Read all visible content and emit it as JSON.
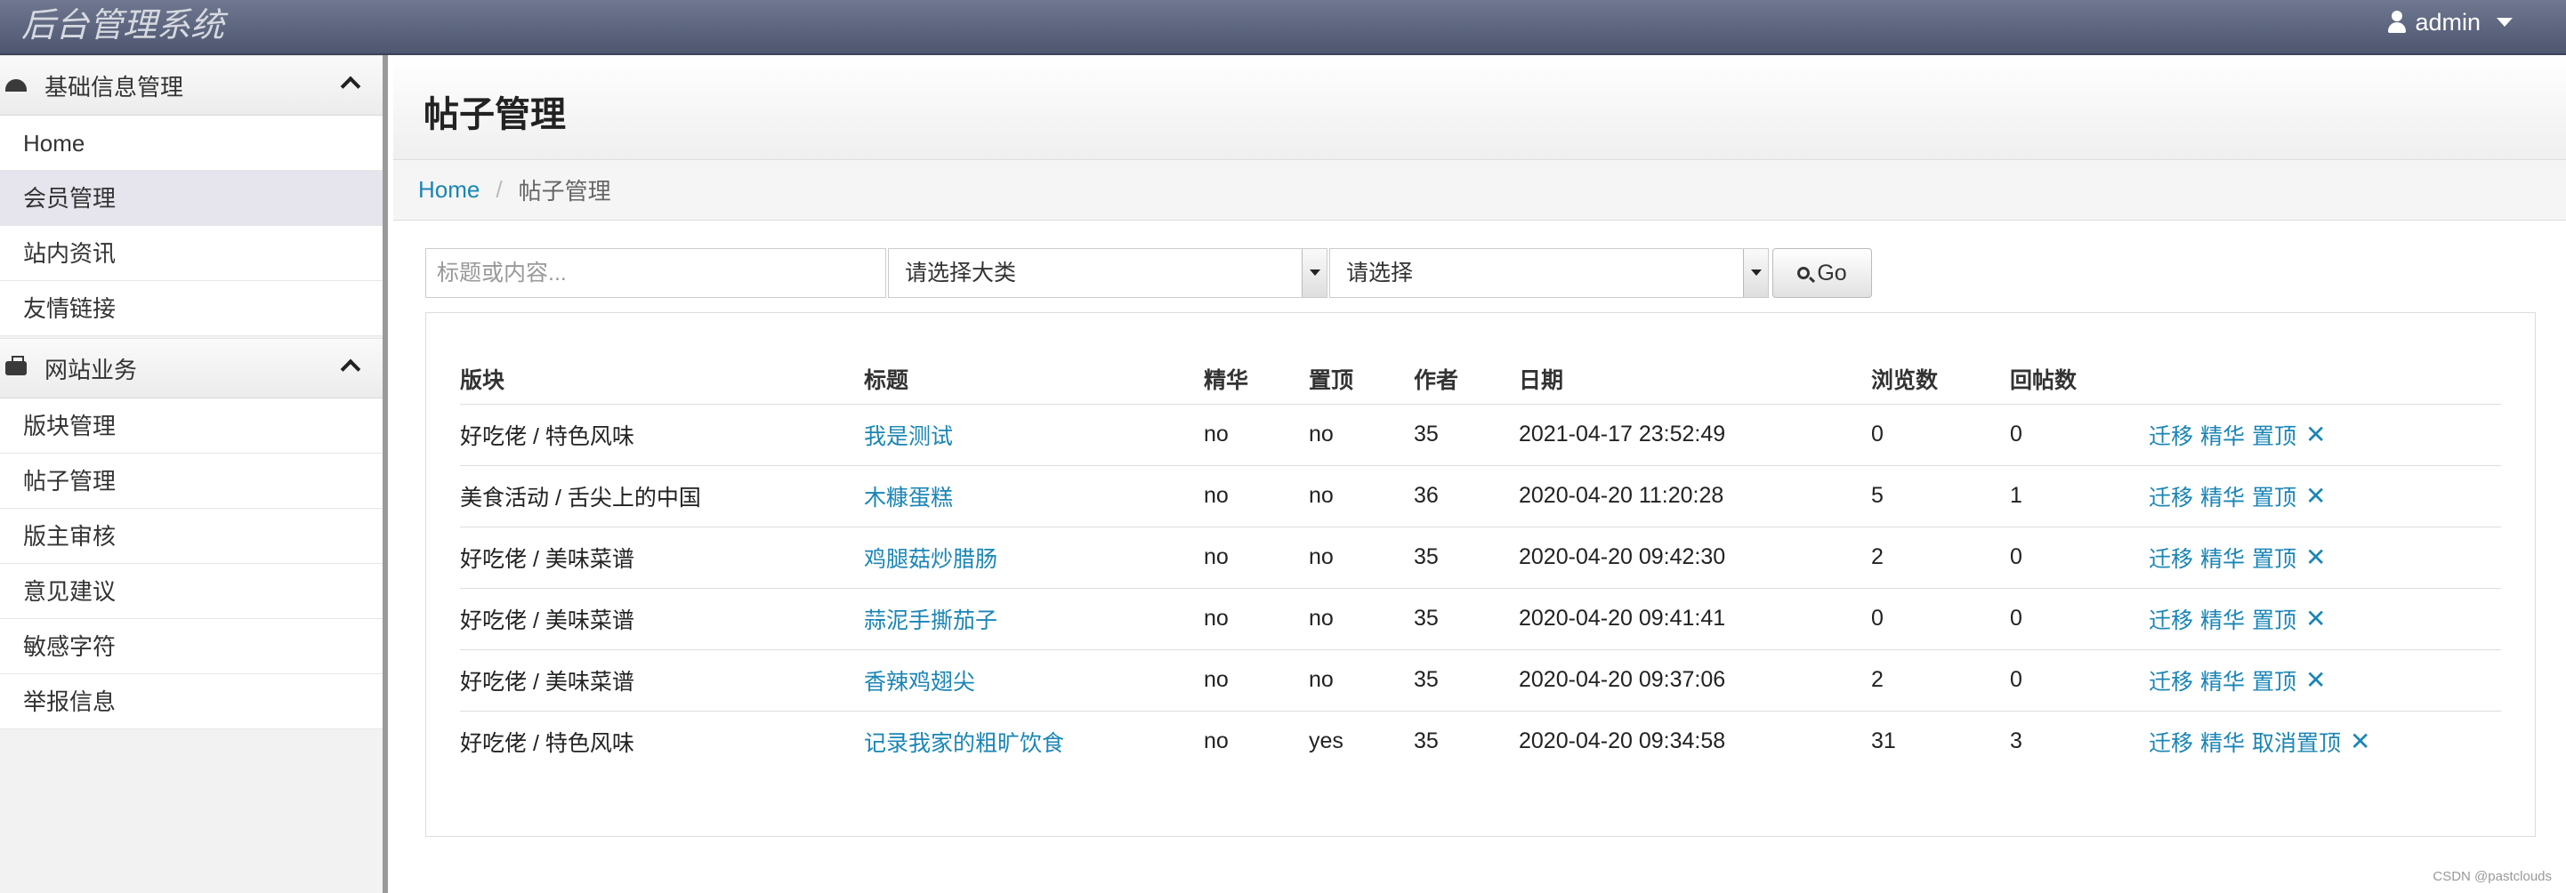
{
  "app": {
    "brand": "后台管理系统",
    "user": "admin"
  },
  "sidebar": {
    "groups": [
      {
        "label": "基础信息管理",
        "icon": "dashboard-icon",
        "items": [
          {
            "label": "Home"
          },
          {
            "label": "会员管理",
            "active": true
          },
          {
            "label": "站内资讯"
          },
          {
            "label": "友情链接"
          }
        ]
      },
      {
        "label": "网站业务",
        "icon": "briefcase-icon",
        "items": [
          {
            "label": "版块管理"
          },
          {
            "label": "帖子管理"
          },
          {
            "label": "版主审核"
          },
          {
            "label": "意见建议"
          },
          {
            "label": "敏感字符"
          },
          {
            "label": "举报信息"
          }
        ]
      }
    ]
  },
  "page": {
    "title": "帖子管理"
  },
  "breadcrumb": {
    "home": "Home",
    "separator": "/",
    "current": "帖子管理"
  },
  "filter": {
    "search_placeholder": "标题或内容...",
    "category_select": "请选择大类",
    "sub_select": "请选择",
    "go_label": "Go"
  },
  "table": {
    "headers": [
      "版块",
      "标题",
      "精华",
      "置顶",
      "作者",
      "日期",
      "浏览数",
      "回帖数",
      ""
    ],
    "rows": [
      {
        "board": "好吃佬 / 特色风味",
        "title": "我是测试",
        "featured": "no",
        "pinned": "no",
        "author": "35",
        "date": "2021-04-17 23:52:49",
        "views": "0",
        "replies": "0",
        "op_move": "迁移",
        "op_feature": "精华",
        "op_pin": "置顶"
      },
      {
        "board": "美食活动 / 舌尖上的中国",
        "title": "木糠蛋糕",
        "featured": "no",
        "pinned": "no",
        "author": "36",
        "date": "2020-04-20 11:20:28",
        "views": "5",
        "replies": "1",
        "op_move": "迁移",
        "op_feature": "精华",
        "op_pin": "置顶"
      },
      {
        "board": "好吃佬 / 美味菜谱",
        "title": "鸡腿菇炒腊肠",
        "featured": "no",
        "pinned": "no",
        "author": "35",
        "date": "2020-04-20 09:42:30",
        "views": "2",
        "replies": "0",
        "op_move": "迁移",
        "op_feature": "精华",
        "op_pin": "置顶"
      },
      {
        "board": "好吃佬 / 美味菜谱",
        "title": "蒜泥手撕茄子",
        "featured": "no",
        "pinned": "no",
        "author": "35",
        "date": "2020-04-20 09:41:41",
        "views": "0",
        "replies": "0",
        "op_move": "迁移",
        "op_feature": "精华",
        "op_pin": "置顶"
      },
      {
        "board": "好吃佬 / 美味菜谱",
        "title": "香辣鸡翅尖",
        "featured": "no",
        "pinned": "no",
        "author": "35",
        "date": "2020-04-20 09:37:06",
        "views": "2",
        "replies": "0",
        "op_move": "迁移",
        "op_feature": "精华",
        "op_pin": "置顶"
      },
      {
        "board": "好吃佬 / 特色风味",
        "title": "记录我家的粗旷饮食",
        "featured": "no",
        "pinned": "yes",
        "author": "35",
        "date": "2020-04-20 09:34:58",
        "views": "31",
        "replies": "3",
        "op_move": "迁移",
        "op_feature": "精华",
        "op_pin": "取消置顶"
      }
    ],
    "delete_glyph": "✕"
  },
  "watermark": "CSDN @pastclouds",
  "colors": {
    "link": "#1a85b6",
    "topbar": "#5b6480"
  }
}
